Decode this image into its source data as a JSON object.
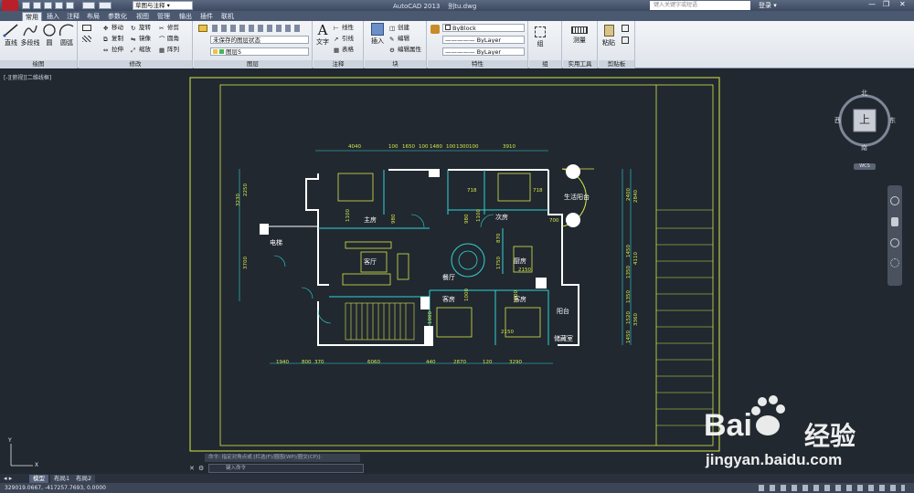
{
  "title_bar": {
    "workspace": "草图与注释",
    "title": "AutoCAD 2013",
    "filename": "别tu.dwg",
    "search_placeholder": "键入关键字或短语",
    "login": "登录"
  },
  "ribbon_tabs": [
    "常用",
    "插入",
    "注释",
    "布局",
    "参数化",
    "视图",
    "管理",
    "输出",
    "插件",
    "联机"
  ],
  "panels": {
    "draw": {
      "label": "绘图",
      "line": "直线",
      "polyline": "多段线",
      "circle": "圆",
      "arc": "圆弧"
    },
    "modify": {
      "label": "修改",
      "move": "移动",
      "rotate": "旋转",
      "trim": "修剪",
      "copy": "复制",
      "mirror": "镜像",
      "fillet": "圆角",
      "stretch": "拉伸",
      "scale": "缩放",
      "array": "阵列"
    },
    "layers": {
      "label": "图层",
      "layer_state": "未保存的图层状态",
      "current_layer": "图层5"
    },
    "annotation": {
      "label": "注释",
      "text": "文字",
      "dim": "线性",
      "leader": "引线",
      "table": "表格"
    },
    "block": {
      "label": "块",
      "insert": "插入",
      "create": "创建",
      "edit": "编辑",
      "edit_attr": "编辑属性"
    },
    "properties": {
      "label": "特性",
      "color": "ByBlock",
      "linetype": "ByLayer",
      "lineweight": "ByLayer"
    },
    "groups": {
      "label": "组",
      "group": "组"
    },
    "utilities": {
      "label": "实用工具",
      "measure": "测量"
    },
    "clipboard": {
      "label": "剪贴板",
      "paste": "粘贴"
    }
  },
  "viewport_label": "[-][俯视][二维线框]",
  "viewcube": {
    "north": "北",
    "south": "南",
    "east": "东",
    "west": "西",
    "top": "上",
    "wcs": "WCS"
  },
  "plan": {
    "rooms": [
      "主房",
      "次房",
      "生活阳台",
      "电梯",
      "客厅",
      "餐厅",
      "厨房",
      "客房",
      "客房",
      "阳台",
      "储藏室"
    ],
    "dims_top": [
      "4040",
      "100",
      "1650",
      "100",
      "1480",
      "100",
      "1300",
      "100",
      "3910"
    ],
    "dims_bottom": [
      "1940",
      "800",
      "370",
      "6060",
      "440",
      "2870",
      "120",
      "3290"
    ],
    "dims_left": [
      "3230",
      "2250",
      "3700"
    ],
    "dims_right": [
      "2400",
      "2840",
      "1450",
      "4110",
      "1350",
      "1350",
      "1520",
      "3360",
      "1450"
    ],
    "inner_dims": [
      "1100",
      "980",
      "718",
      "1100",
      "980",
      "718",
      "870",
      "2150",
      "1000",
      "1750",
      "1000",
      "1000",
      "2150",
      "700"
    ]
  },
  "command": {
    "history": "命令: 指定对角点或 [栏选(F)/圈围(WP)/圈交(CP)]:",
    "prompt": "键入命令"
  },
  "layouts": [
    "模型",
    "布局1",
    "布局2"
  ],
  "status": {
    "coords": "329019.0667, -417257.7693, 0.0000"
  },
  "watermark": {
    "brand": "Bai",
    "brand2": "经验",
    "url": "jingyan.baidu.com"
  }
}
